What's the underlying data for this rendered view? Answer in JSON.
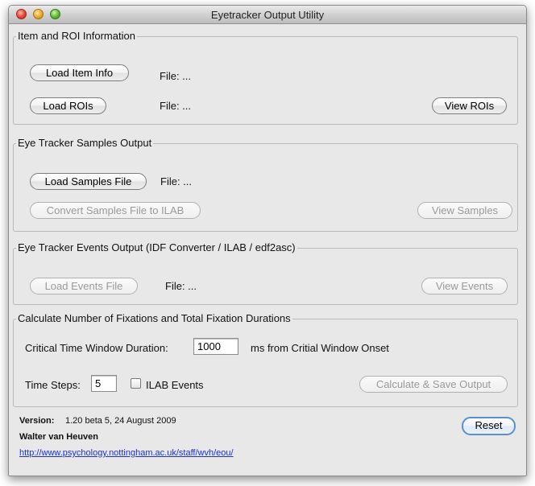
{
  "window": {
    "title": "Eyetracker Output Utility"
  },
  "item_roi": {
    "title": "Item and ROI Information",
    "load_item_label": "Load Item Info",
    "item_file_label": "File:  ...",
    "load_rois_label": "Load ROIs",
    "rois_file_label": "File:  ...",
    "view_rois_label": "View ROIs"
  },
  "samples": {
    "title": "Eye Tracker Samples Output",
    "load_label": "Load Samples File",
    "file_label": "File:  ...",
    "convert_label": "Convert Samples File to ILAB",
    "view_label": "View Samples"
  },
  "events": {
    "title": "Eye Tracker Events Output (IDF Converter / ILAB / edf2asc)",
    "load_label": "Load Events File",
    "file_label": "File:  ...",
    "view_label": "View Events"
  },
  "calc": {
    "title": "Calculate Number of Fixations and Total Fixation Durations",
    "window_label": "Critical Time Window Duration:",
    "window_value": "1000",
    "window_suffix": "ms from Critial Window Onset",
    "steps_label": "Time Steps:",
    "steps_value": "5",
    "ilab_label": "ILAB Events",
    "ilab_checked": false,
    "save_label": "Calculate & Save Output"
  },
  "footer": {
    "version_label": "Version:",
    "version_value": "1.20 beta 5, 24 August 2009",
    "author": "Walter van Heuven",
    "url": "http://www.psychology.nottingham.ac.uk/staff/wvh/eou/",
    "reset_label": "Reset"
  }
}
